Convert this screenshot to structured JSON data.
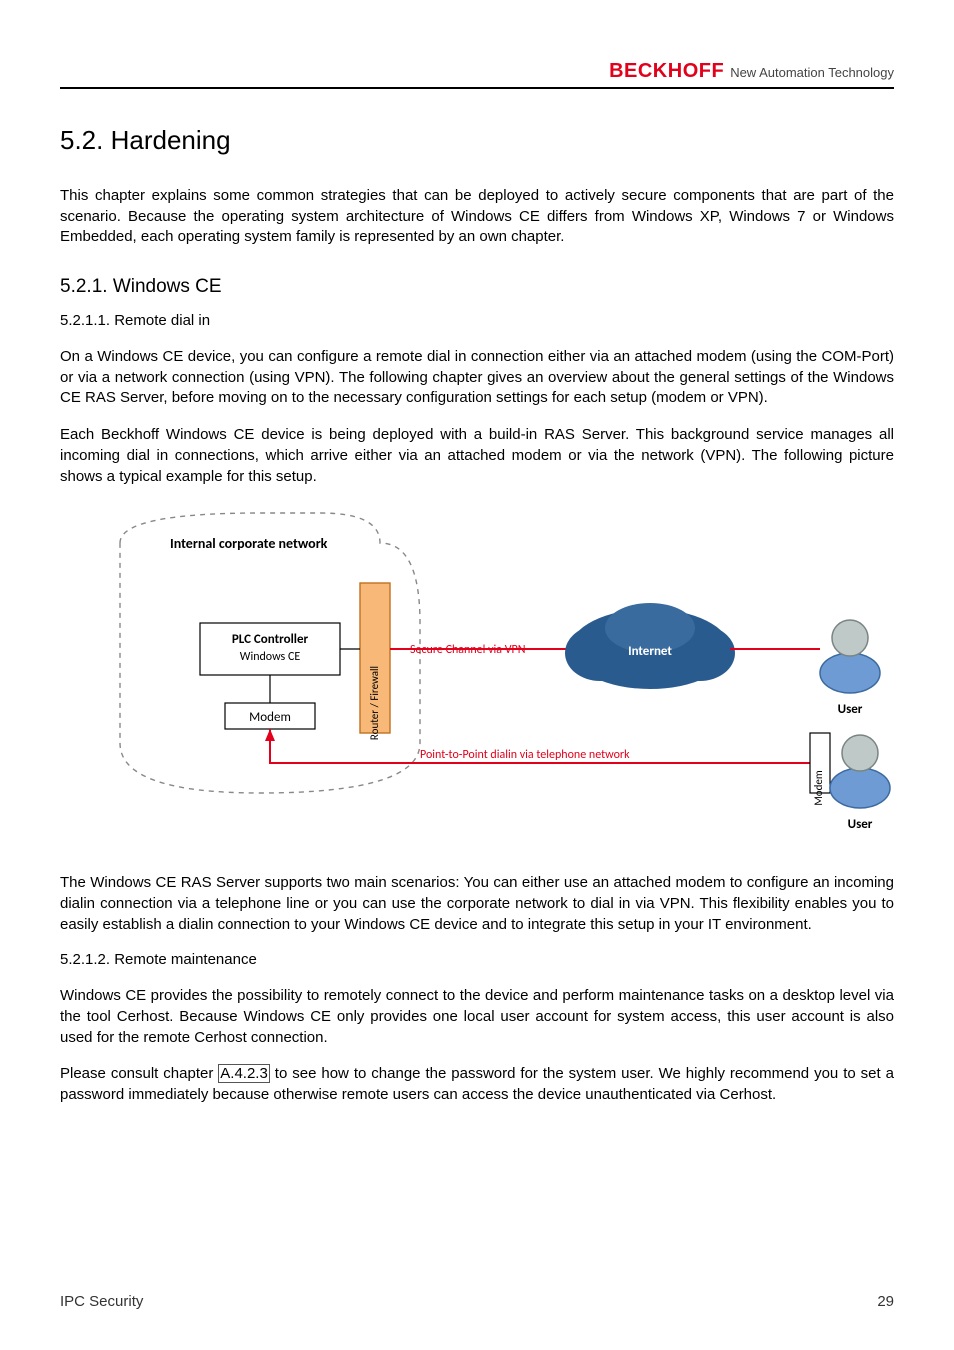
{
  "header": {
    "brand_main": "BECKHOFF",
    "brand_sub": "New Automation Technology"
  },
  "section": {
    "number_title": "5.2. Hardening",
    "intro_para": "This chapter explains some common strategies that can be deployed to actively secure components that are part of the scenario. Because the operating system architecture of Windows CE differs from Windows XP, Windows 7 or Windows Embedded, each operating system family is represented by an own chapter."
  },
  "sub1": {
    "heading": "5.2.1. Windows CE",
    "sub_a": {
      "heading": "5.2.1.1. Remote dial in",
      "para1": "On a Windows CE device, you can configure a remote dial in connection either via an attached modem (using the COM-Port) or via a network connection (using VPN). The following chapter gives an overview about the general settings of the Windows CE RAS Server, before moving on to the necessary configuration settings for each setup (modem or VPN).",
      "para2": "Each Beckhoff Windows CE device is being deployed with a build-in RAS Server. This background service manages all incoming dial in connections, which arrive either via an attached modem or via the network (VPN). The following picture shows a typical example for this setup.",
      "diagram": {
        "corp_net_label": "Internal corporate network",
        "plc_label": "PLC Controller",
        "plc_sub": "Windows CE",
        "modem_l": "Modem",
        "router_label": "Router / Firewall",
        "vpn_label": "Secure Channel via VPN",
        "internet_label": "Internet",
        "user_label": "User",
        "modem_r": "Modem",
        "ptp_label": "Point-to-Point dialin via telephone network"
      },
      "para3": "The Windows CE RAS Server supports two main scenarios: You can either use an attached modem to configure an incoming dialin connection via a telephone line or you can use the corporate network to dial in via VPN. This flexibility enables you to easily establish a dialin connection to your Windows CE device and to integrate this setup in your IT environment."
    },
    "sub_b": {
      "heading": "5.2.1.2. Remote maintenance",
      "para1": "Windows CE provides the possibility to remotely connect to the device and perform maintenance tasks on a desktop level via the tool Cerhost. Because Windows CE only provides one local user account for system access, this user account is also used for the remote Cerhost connection.",
      "para2_pre": "Please consult chapter ",
      "para2_link": "A.4.2.3",
      "para2_post": " to see how to change the password for the system user. We highly recommend you to set a password immediately because otherwise remote users can access the device unauthenticated via Cerhost."
    }
  },
  "footer": {
    "left": "IPC Security",
    "right": "29"
  }
}
